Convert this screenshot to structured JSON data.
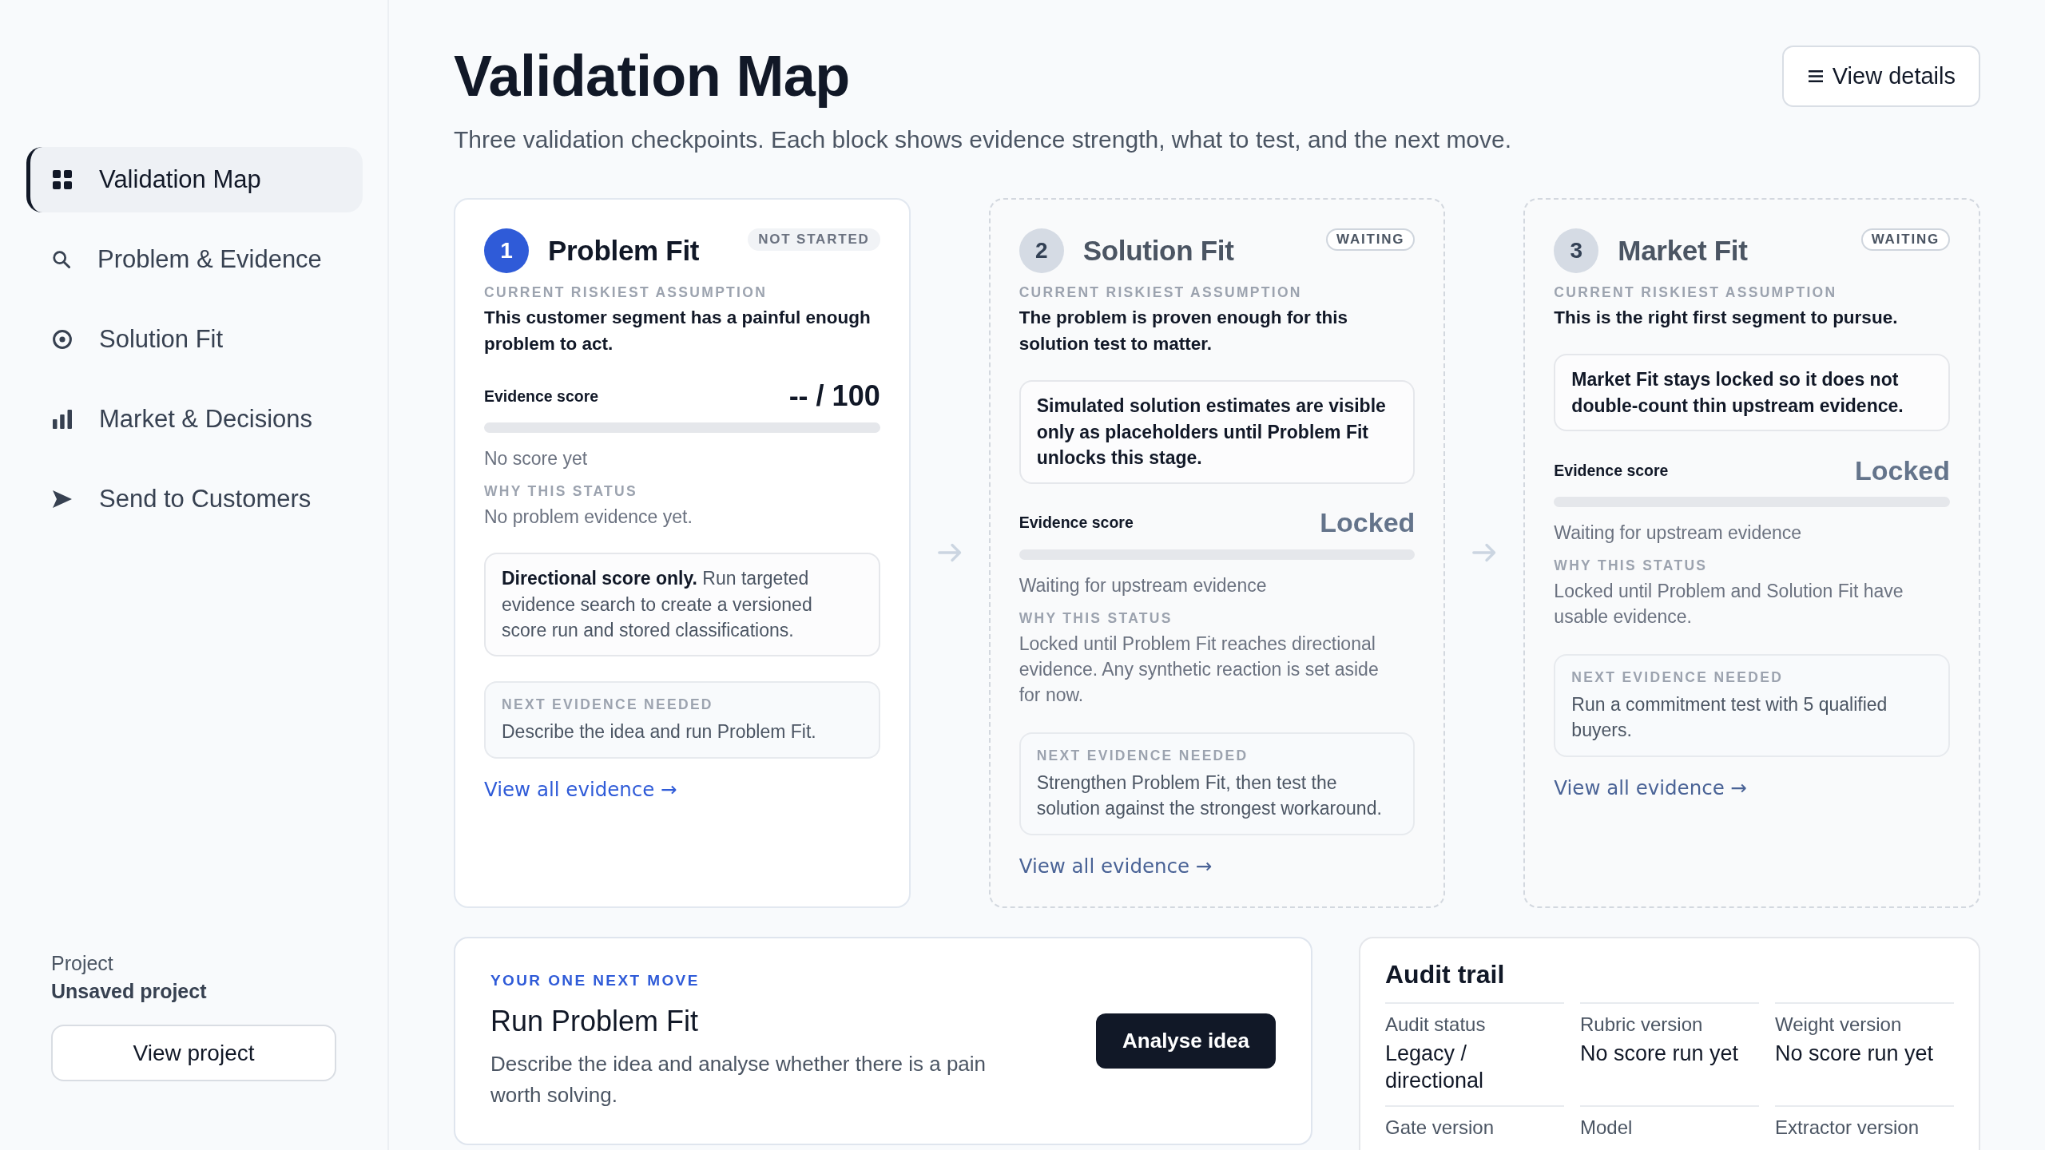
{
  "sidebar": {
    "nav_items": [
      {
        "label": "Validation Map",
        "selected": true
      },
      {
        "label": "Problem & Evidence",
        "selected": false
      },
      {
        "label": "Solution Fit",
        "selected": false
      },
      {
        "label": "Market & Decisions",
        "selected": false
      },
      {
        "label": "Send to Customers",
        "selected": false
      }
    ],
    "project": {
      "label": "Project",
      "name": "Unsaved project",
      "button": "View project"
    }
  },
  "header": {
    "title": "Validation Map",
    "subtitle": "Three validation checkpoints. Each block shows evidence strength, what to test, and the next move.",
    "button": "View details"
  },
  "stages": [
    {
      "number": "1",
      "title": "Problem Fit",
      "status": {
        "label": "NOT STARTED",
        "kind": "not_started"
      },
      "locked": false,
      "sections": [
        {
          "kind": "assumption",
          "label": "CURRENT RISKIEST ASSUMPTION",
          "text": "This customer segment has a painful enough problem to act."
        },
        {
          "kind": "score",
          "label": "Evidence score",
          "value": "-- / 100",
          "caption": "No score yet"
        },
        {
          "kind": "why",
          "label": "WHY THIS STATUS",
          "text": "No problem evidence yet."
        },
        {
          "kind": "notice",
          "bold": false,
          "text": "**Directional score only.** Run targeted evidence search to create a versioned score run and stored classifications."
        },
        {
          "kind": "next",
          "label": "NEXT EVIDENCE NEEDED",
          "text": "Describe the idea and run Problem Fit."
        }
      ],
      "link": "View all evidence →"
    },
    {
      "number": "2",
      "title": "Solution Fit",
      "status": {
        "label": "WAITING",
        "kind": "waiting"
      },
      "locked": true,
      "sections": [
        {
          "kind": "assumption",
          "label": "CURRENT RISKIEST ASSUMPTION",
          "text": "The problem is proven enough for this solution test to matter."
        },
        {
          "kind": "notice",
          "bold": true,
          "text": "Simulated solution estimates are visible only as placeholders until Problem Fit unlocks this stage."
        },
        {
          "kind": "score",
          "label": "Evidence score",
          "value": "Locked",
          "caption": "Waiting for upstream evidence"
        },
        {
          "kind": "why",
          "label": "WHY THIS STATUS",
          "text": "Locked until Problem Fit reaches directional evidence. Any synthetic reaction is set aside for now."
        },
        {
          "kind": "next",
          "label": "NEXT EVIDENCE NEEDED",
          "text": "Strengthen Problem Fit, then test the solution against the strongest workaround."
        }
      ],
      "link": "View all evidence →"
    },
    {
      "number": "3",
      "title": "Market Fit",
      "status": {
        "label": "WAITING",
        "kind": "waiting"
      },
      "locked": true,
      "sections": [
        {
          "kind": "assumption",
          "label": "CURRENT RISKIEST ASSUMPTION",
          "text": "This is the right first segment to pursue."
        },
        {
          "kind": "notice",
          "bold": true,
          "text": "Market Fit stays locked so it does not double-count thin upstream evidence."
        },
        {
          "kind": "score",
          "label": "Evidence score",
          "value": "Locked",
          "caption": "Waiting for upstream evidence"
        },
        {
          "kind": "why",
          "label": "WHY THIS STATUS",
          "text": "Locked until Problem and Solution Fit have usable evidence."
        },
        {
          "kind": "next",
          "label": "NEXT EVIDENCE NEEDED",
          "text": "Run a commitment test with 5 qualified buyers."
        }
      ],
      "link": "View all evidence →"
    }
  ],
  "next_move": {
    "eyebrow": "YOUR ONE NEXT MOVE",
    "title": "Run Problem Fit",
    "description": "Describe the idea and analyse whether there is a pain worth solving.",
    "button": "Analyse idea"
  },
  "audit_trail": {
    "title": "Audit trail",
    "fields": [
      {
        "label": "Audit status",
        "value": "Legacy / directional"
      },
      {
        "label": "Rubric version",
        "value": "No score run yet"
      },
      {
        "label": "Weight version",
        "value": "No score run yet"
      },
      {
        "label": "Gate version"
      },
      {
        "label": "Model"
      },
      {
        "label": "Extractor version"
      }
    ]
  }
}
